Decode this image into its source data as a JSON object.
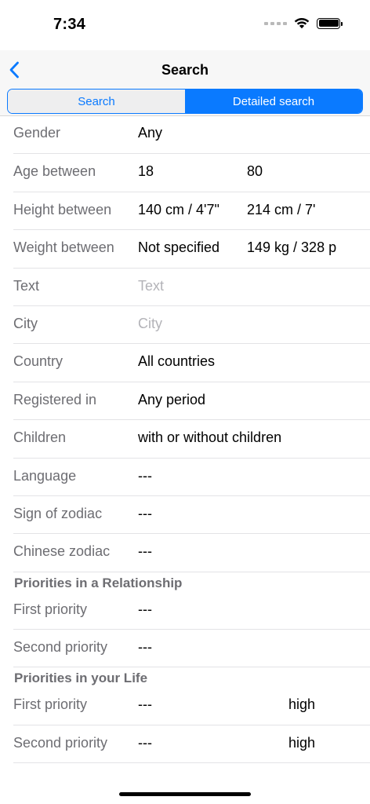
{
  "status": {
    "time": "7:34"
  },
  "nav": {
    "title": "Search"
  },
  "tabs": [
    {
      "label": "Search",
      "selected": false
    },
    {
      "label": "Detailed search",
      "selected": true
    }
  ],
  "fields": {
    "gender": {
      "label": "Gender",
      "value": "Any"
    },
    "age": {
      "label": "Age between",
      "from": "18",
      "to": "80"
    },
    "height": {
      "label": "Height between",
      "from": "140 cm / 4'7\"",
      "to": "214 cm / 7'"
    },
    "weight": {
      "label": "Weight between",
      "from": "Not specified",
      "to": "149 kg / 328 p"
    },
    "text": {
      "label": "Text",
      "placeholder": "Text"
    },
    "city": {
      "label": "City",
      "placeholder": "City"
    },
    "country": {
      "label": "Country",
      "value": "All countries"
    },
    "registered": {
      "label": "Registered in",
      "value": "Any period"
    },
    "children": {
      "label": "Children",
      "value": "with or without children"
    },
    "language": {
      "label": "Language",
      "value": "---"
    },
    "zodiac": {
      "label": "Sign of zodiac",
      "value": "---"
    },
    "chinese_zodiac": {
      "label": "Chinese zodiac",
      "value": "---"
    }
  },
  "relationship": {
    "header": "Priorities in a Relationship",
    "first": {
      "label": "First priority",
      "value": "---"
    },
    "second": {
      "label": "Second priority",
      "value": "---"
    }
  },
  "life": {
    "header": "Priorities in your Life",
    "first": {
      "label": "First priority",
      "value": "---",
      "level": "high"
    },
    "second": {
      "label": "Second priority",
      "value": "---",
      "level": "high"
    }
  },
  "colors": {
    "accent": "#0a7aff",
    "label": "#6d6d72",
    "placeholder": "#b3b3b8"
  }
}
